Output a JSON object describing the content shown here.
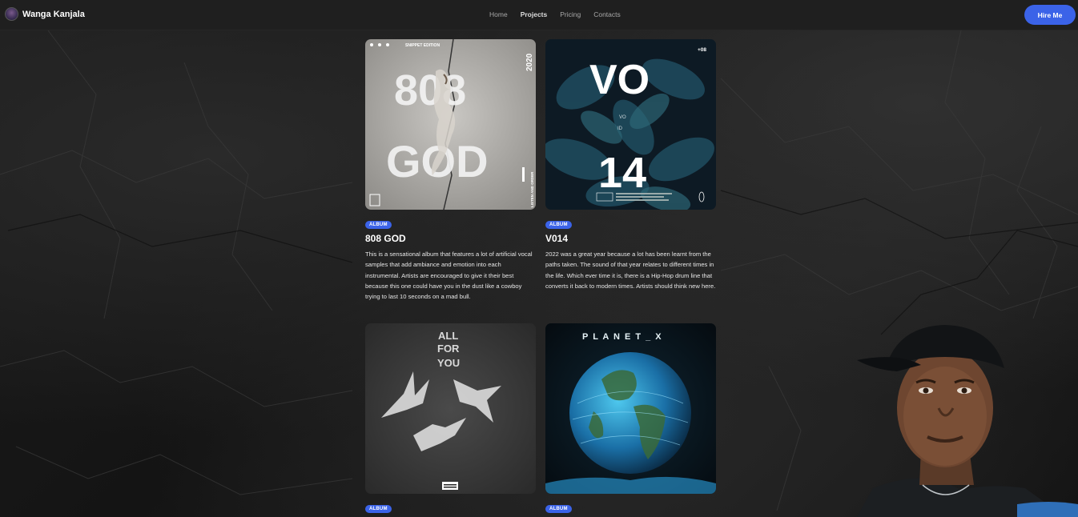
{
  "nav": {
    "brand": "Wanga Kanjala",
    "links": [
      "Home",
      "Projects",
      "Pricing",
      "Contacts"
    ],
    "active": "Projects",
    "cta": "Hire Me"
  },
  "projects": [
    {
      "badge": "ALBUM",
      "title": "808 GOD",
      "description": "This is a sensational album that features a lot of artificial vocal samples that add ambiance and emotion into each instrumental. Artists are encouraged to give it their best because this one could have you in the dust like a cowboy trying to last 10 seconds on a mad bull.",
      "cover": {
        "top_text": "SNIPPET EDITION",
        "main_text_1": "808",
        "main_text_2": "GOD",
        "year": "2020",
        "side_text": "LISTEN AND ORDER"
      }
    },
    {
      "badge": "ALBUM",
      "title": "V014",
      "description": "2022 was a great year because a lot has been learnt from the paths taken. The sound of that year relates to different times in the life. Which ever time it is, there is a Hip-Hop drum line that converts it back to modern times. Artists should think new here.",
      "cover": {
        "corner_text": "+08",
        "main_text_1": "VO",
        "main_text_2": "14",
        "small_1": "VO",
        "small_2": "ID"
      }
    },
    {
      "badge": "ALBUM",
      "title": "",
      "description": "",
      "cover": {
        "line_1": "ALL",
        "line_2": "FOR",
        "line_3": "YOU"
      }
    },
    {
      "badge": "ALBUM",
      "title": "",
      "description": "",
      "cover": {
        "title": "P L A N E T _ X"
      }
    }
  ],
  "colors": {
    "accent": "#3b63e8",
    "navbar": "#1f1f1f"
  }
}
